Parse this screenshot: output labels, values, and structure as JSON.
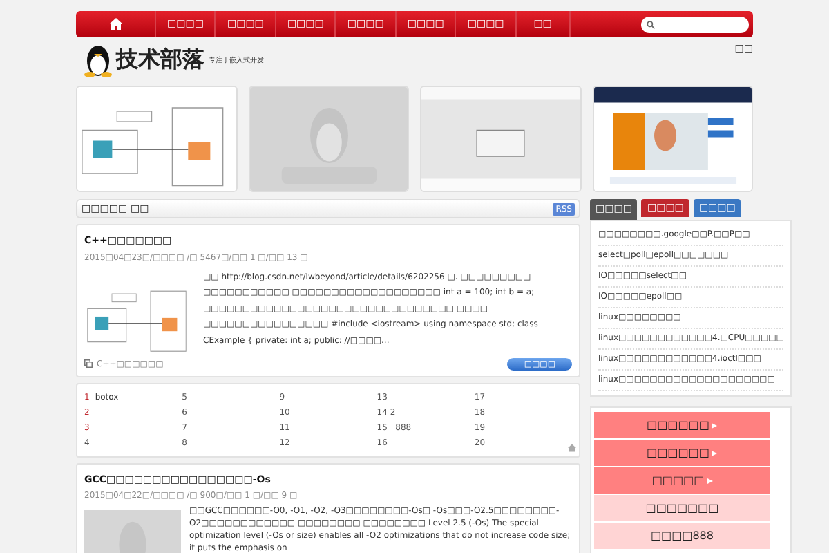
{
  "nav": {
    "items": [
      {
        "kind": "home"
      },
      {
        "kind": "text",
        "label": "□□□□"
      },
      {
        "kind": "text",
        "label": "□□□□"
      },
      {
        "kind": "text",
        "label": "□□□□"
      },
      {
        "kind": "text",
        "label": "□□□□"
      },
      {
        "kind": "text",
        "label": "□□□□"
      },
      {
        "kind": "text",
        "label": "□□□□"
      },
      {
        "kind": "text",
        "label": "□□"
      }
    ]
  },
  "header": {
    "logo": "技术部落",
    "slogan": "专注于嵌入式开发",
    "link": "□□"
  },
  "thumbnails": [
    {
      "kind": "diagram"
    },
    {
      "kind": "tux"
    },
    {
      "kind": "dialog"
    },
    {
      "kind": "website"
    }
  ],
  "section": {
    "title": "□□□□□ □□",
    "rss": "RSS"
  },
  "posts": [
    {
      "title": "C++□□□□□□□",
      "meta": "2015□04□23□/□□□□ /□ 5467□/□□ 1 □/□□ 13 □",
      "excerpt": "□□ http://blog.csdn.net/lwbeyond/article/details/6202256 □. □□□□□□□□□ □□□□□□□□□□□ □□□□□□□□□□□□□□□□□□□ int a = 100; int b = a; □□□□□□□□□□□□□□□□□□□□□□□□□□□□□□□□ □□□□ □□□□□□□□□□□□□□□□ #include <iostream> using namespace std; class CExample { private: int a; public: //□□□□...",
      "tag": "C++□□□□□□",
      "button": "□□□□"
    }
  ],
  "table": {
    "rows": [
      {
        "rank": "1",
        "hot": true,
        "name": "botox",
        "cells": [
          "5",
          "9",
          "13",
          "17"
        ]
      },
      {
        "rank": "2",
        "hot": true,
        "cells": [
          "6",
          "10",
          "14 2",
          "18"
        ]
      },
      {
        "rank": "3",
        "hot": true,
        "cells": [
          "7",
          "11",
          "15   888",
          "19"
        ]
      },
      {
        "rank": "4",
        "hot": false,
        "cells": [
          "8",
          "12",
          "16",
          "20"
        ]
      }
    ]
  },
  "post2": {
    "title": "GCC□□□□□□□□□□□□□□□□-Os",
    "meta": "2015□04□22□/□□□□ /□ 900□/□□ 1 □/□□ 9 □",
    "excerpt": "□□GCC□□□□□□-O0, -O1, -O2, -O3□□□□□□□□-Os□ -Os□□□-O2.5□□□□□□□□-O2□□□□□□□□□□□□ □□□□□□□□ □□□□□□□□ Level 2.5 (-Os) The special optimization level (-Os or size) enables all -O2 optimizations that do not increase code size; it puts the emphasis on"
  },
  "sidebar": {
    "tabs": [
      {
        "label": "□□□□",
        "selected": true,
        "color": "#555555"
      },
      {
        "label": "□□□□",
        "selected": false,
        "color": "#c0272d"
      },
      {
        "label": "□□□□",
        "selected": false,
        "color": "#3a78c3"
      }
    ],
    "list": [
      "□□□□□□□□.google□□P.□□P□□",
      "select□poll□epoll□□□□□□□",
      "IO□□□□□select□□",
      "IO□□□□□epoll□□",
      "linux□□□□□□□□",
      "linux□□□□□□□□□□□□4.□CPU□□□□□",
      "linux□□□□□□□□□□□□4.ioctl□□□",
      "linux□□□□□□□□□□□□□□□□□□□□"
    ],
    "menu": [
      {
        "label": "□□□□□□",
        "arrow": true
      },
      {
        "label": "□□□□□□",
        "arrow": true
      },
      {
        "label": "□□□□□",
        "arrow": true
      },
      {
        "label": "□□□□□□□",
        "arrow": false
      },
      {
        "label": "□□□□888",
        "arrow": false
      }
    ]
  }
}
